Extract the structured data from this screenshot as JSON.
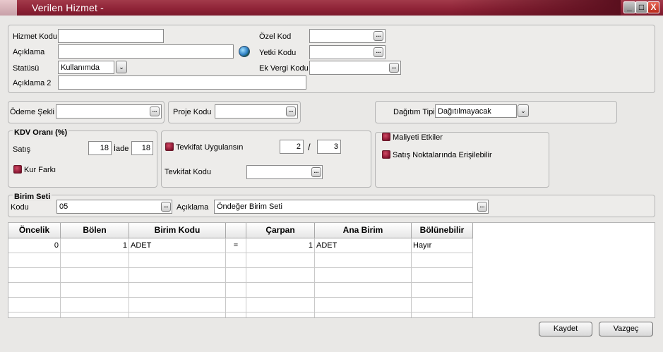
{
  "window": {
    "title": "Verilen Hizmet -",
    "buttons": {
      "minimize": "_",
      "maximize": "□",
      "close": "X"
    }
  },
  "general": {
    "hizmet_kodu_label": "Hizmet Kodu",
    "hizmet_kodu_value": "",
    "aciklama_label": "Açıklama",
    "aciklama_value": "",
    "statusu_label": "Statüsü",
    "statusu_value": "Kullanımda",
    "aciklama2_label": "Açıklama 2",
    "aciklama2_value": "",
    "ozel_kod_label": "Özel Kod",
    "ozel_kod_value": "",
    "yetki_kodu_label": "Yetki Kodu",
    "yetki_kodu_value": "",
    "ek_vergi_kodu_label": "Ek Vergi Kodu",
    "ek_vergi_kodu_value": ""
  },
  "payment": {
    "odeme_sekli_label": "Ödeme Şekli",
    "odeme_sekli_value": "",
    "proje_kodu_label": "Proje Kodu",
    "proje_kodu_value": "",
    "dagitim_tipi_label": "Dağıtım Tipi",
    "dagitim_tipi_value": "Dağıtılmayacak"
  },
  "kdv": {
    "group_label": "KDV Oranı (%)",
    "satis_label": "Satış",
    "satis_value": "18",
    "iade_label": "İade",
    "iade_value": "18",
    "kur_farki_label": "Kur Farkı"
  },
  "tevkifat": {
    "uygulansin_label": "Tevkifat Uygulansın",
    "num1": "2",
    "slash": "/",
    "num2": "3",
    "kodu_label": "Tevkifat Kodu",
    "kodu_value": ""
  },
  "options": {
    "maliyeti_etkiler_label": "Maliyeti Etkiler",
    "satis_noktalari_label": "Satış Noktalarında Erişilebilir"
  },
  "birim_seti": {
    "group_label": "Birim Seti",
    "kodu_label": "Kodu",
    "kodu_value": "05",
    "aciklama_label": "Açıklama",
    "aciklama_value": "Öndeğer Birim Seti"
  },
  "grid": {
    "headers": [
      "Öncelik",
      "Bölen",
      "Birim Kodu",
      "",
      "Çarpan",
      "Ana Birim",
      "Bölünebilir"
    ],
    "rows": [
      [
        "0",
        "1",
        "ADET",
        "=",
        "1",
        "ADET",
        "Hayır"
      ]
    ]
  },
  "footer": {
    "kaydet_label": "Kaydet",
    "vazgec_label": "Vazgeç"
  }
}
